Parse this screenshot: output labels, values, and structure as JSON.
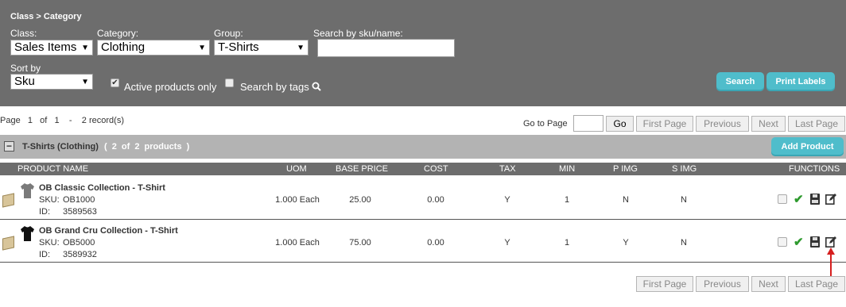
{
  "breadcrumb": "Class > Category",
  "filters": {
    "class_label": "Class:",
    "class_value": "Sales Items",
    "category_label": "Category:",
    "category_value": "Clothing",
    "group_label": "Group:",
    "group_value": "T-Shirts",
    "search_label": "Search by sku/name:",
    "search_value": "",
    "sort_label": "Sort by",
    "sort_value": "Sku",
    "active_only_label": "Active products only",
    "active_only_checked": true,
    "search_tags_label": "Search by tags",
    "search_tags_checked": false,
    "search_button": "Search",
    "print_labels_button": "Print Labels"
  },
  "pager_top": {
    "page_word": "Page",
    "page": "1",
    "of_word": "of",
    "total_pages": "1",
    "dash": "-",
    "records": "2 record(s)",
    "goto_label": "Go to Page",
    "goto_value": "",
    "go_button": "Go",
    "first": "First Page",
    "previous": "Previous",
    "next": "Next",
    "last": "Last Page"
  },
  "group": {
    "expand_symbol": "−",
    "title": "T-Shirts (Clothing)",
    "count": "( 2 of 2 products )",
    "add_button": "Add Product"
  },
  "columns": [
    "PRODUCT NAME",
    "UOM",
    "BASE PRICE",
    "COST",
    "TAX",
    "MIN",
    "P IMG",
    "S IMG",
    "FUNCTIONS"
  ],
  "products": [
    {
      "name": "OB Classic Collection - T-Shirt",
      "sku_label": "SKU:",
      "sku": "OB1000",
      "id_label": "ID:",
      "id": "3589563",
      "uom": "1.000 Each",
      "base_price": "25.00",
      "cost": "0.00",
      "tax": "Y",
      "min": "1",
      "p_img": "N",
      "s_img": "N",
      "shirt_color": "#7a7a7a"
    },
    {
      "name": "OB Grand Cru Collection - T-Shirt",
      "sku_label": "SKU:",
      "sku": "OB5000",
      "id_label": "ID:",
      "id": "3589932",
      "uom": "1.000 Each",
      "base_price": "75.00",
      "cost": "0.00",
      "tax": "Y",
      "min": "1",
      "p_img": "Y",
      "s_img": "N",
      "shirt_color": "#111111"
    }
  ],
  "pager_bottom": {
    "first": "First Page",
    "previous": "Previous",
    "next": "Next",
    "last": "Last Page"
  },
  "colors": {
    "panel": "#6d6d6d",
    "accent": "#4fbdcb",
    "group_bar": "#b3b3b3",
    "check_green": "#2e9a2e",
    "annotation_red": "#d61f1f"
  },
  "icons": [
    "search-icon",
    "box-icon",
    "tshirt-icon",
    "checkmark-icon",
    "save-icon",
    "edit-icon",
    "red-arrow"
  ]
}
